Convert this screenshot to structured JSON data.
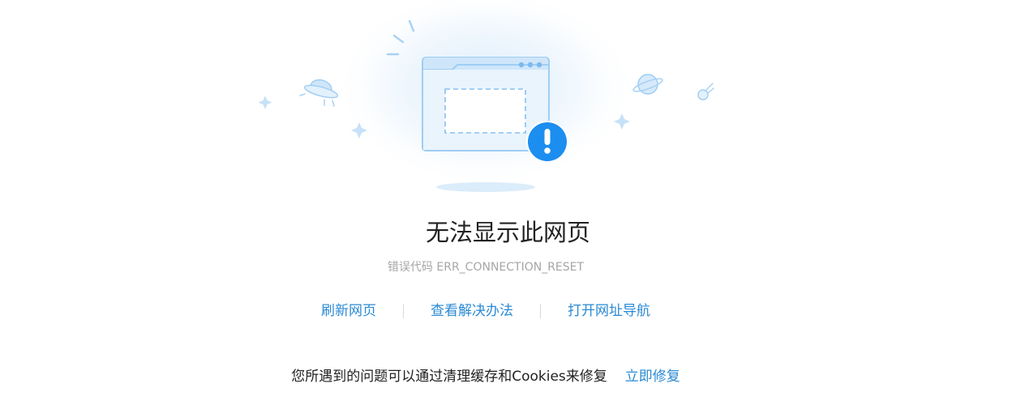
{
  "error": {
    "title": "无法显示此网页",
    "code_text": "错误代码 ERR_CONNECTION_RESET"
  },
  "actions": [
    {
      "label": "刷新网页"
    },
    {
      "label": "查看解决办法"
    },
    {
      "label": "打开网址导航"
    }
  ],
  "tip": {
    "message": "您所遇到的问题可以通过清理缓存和Cookies来修复",
    "fix_label": "立即修复"
  },
  "icons": {
    "illustration": "broken-browser-window-icon",
    "warning": "exclamation-badge-icon",
    "ufo": "ufo-icon",
    "planet": "planet-icon",
    "comet": "comet-icon",
    "sparkle": "sparkle-icon"
  },
  "colors": {
    "accent": "#2a8ad4",
    "badge": "#1c8ef0",
    "window_fill": "#e9f4fd",
    "window_stroke": "#9fcdf3"
  }
}
